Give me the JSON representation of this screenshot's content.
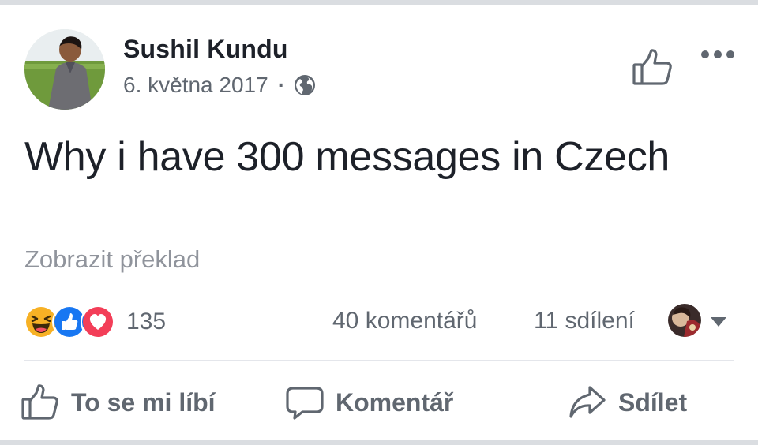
{
  "post": {
    "author": "Sushil Kundu",
    "date": "6. května 2017",
    "separator": "·",
    "privacy_icon": "globe-icon",
    "text": "Why i have 300 messages in Czech",
    "translate_label": "Zobrazit překlad"
  },
  "stats": {
    "reactions": [
      "haha",
      "like",
      "love"
    ],
    "reaction_count": "135",
    "comments": "40 komentářů",
    "shares": "11 sdílení"
  },
  "actions": {
    "like_label": "To se mi líbí",
    "comment_label": "Komentář",
    "share_label": "Sdílet"
  },
  "colors": {
    "like_blue": "#1877f2",
    "love_red": "#f33e58",
    "haha_yellow": "#f7b125",
    "text_secondary": "#606770",
    "text_muted": "#90949c"
  }
}
